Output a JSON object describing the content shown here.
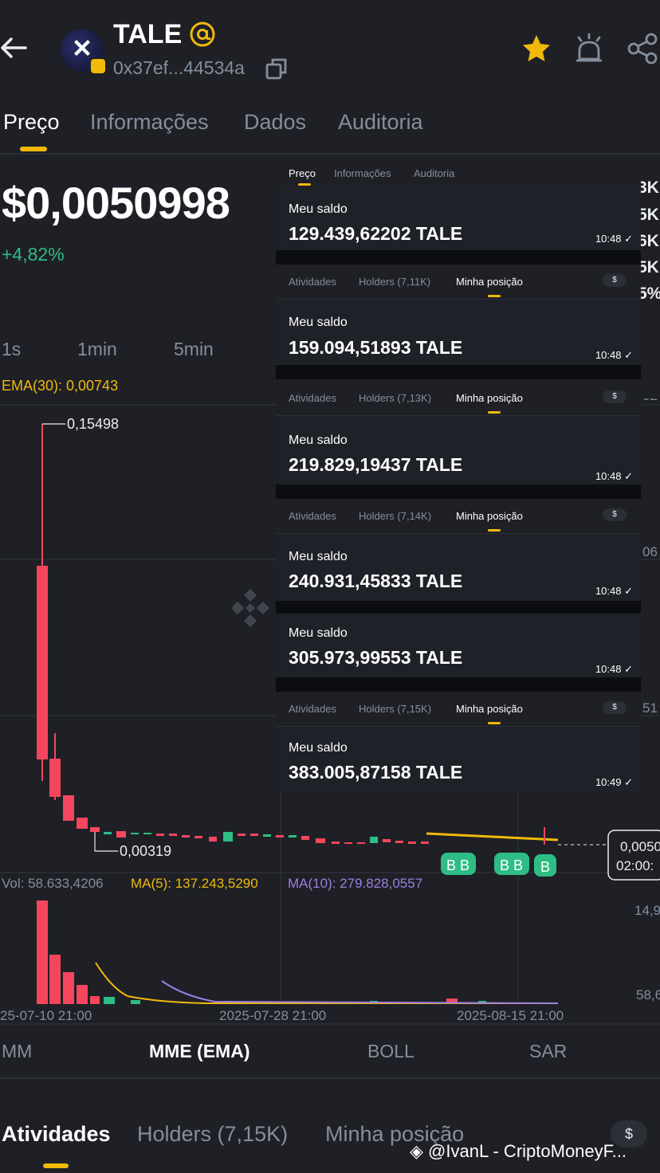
{
  "header": {
    "token_name": "TALE",
    "address": "0x37ef...44534a",
    "icons": [
      "back-arrow-icon",
      "token-logo",
      "at-icon",
      "copy-icon",
      "star-icon",
      "alert-icon",
      "share-icon"
    ]
  },
  "main_tabs": [
    "Preço",
    "Informações",
    "Dados",
    "Auditoria"
  ],
  "price": {
    "value": "$0,0050998",
    "change": "+4,82%"
  },
  "right_stats": [
    "3K",
    "5K",
    "6K",
    "5K",
    "5%"
  ],
  "timeframes": [
    "1s",
    "1min",
    "5min"
  ],
  "ema_label": "EMA(30): 0,00743",
  "chart": {
    "high_label": "0,15498",
    "low_label": "0,00319",
    "current_price_label": "0,0050",
    "current_time_label": "02:00:",
    "right_axis": [
      "62",
      "06",
      "51"
    ],
    "vol_label": "Vol: 58.633,4206",
    "ma5_label": "MA(5): 137.243,5290",
    "ma10_label": "MA(10): 279.828,0557",
    "vol_axis": [
      "14,9",
      "58,6"
    ],
    "dates": [
      "25-07-10 21:00",
      "2025-07-28 21:00",
      "2025-08-15 21:00"
    ],
    "buy_markers": [
      "B",
      "B",
      "B",
      "B",
      "B"
    ]
  },
  "chart_data": {
    "type": "candlestick",
    "title": "",
    "x_labels": [
      "25-07-10 21:00",
      "2025-07-28 21:00",
      "2025-08-15 21:00"
    ],
    "high": 0.15498,
    "low": 0.00319,
    "last": 0.0050998,
    "ema30": 0.00743,
    "volume": 58633.4206,
    "ma5_volume": 137243.529,
    "ma10_volume": 279828.0557
  },
  "indicator_tabs": [
    "MM",
    "MME (EMA)",
    "BOLL",
    "SAR"
  ],
  "bottom_tabs": {
    "atividades": "Atividades",
    "holders": "Holders (7,15K)",
    "minha_posicao": "Minha posição",
    "dollar": "$"
  },
  "watermark": "@IvanL - CriptoMoneyF...",
  "overlay": {
    "first_tabs": [
      "Preço",
      "Informações",
      "Auditoria"
    ],
    "saldo_label": "Meu saldo",
    "entries": [
      {
        "holders": "",
        "value": "129.439,62202 TALE",
        "time": "10:48 ✓"
      },
      {
        "holders": "Holders (7,11K)",
        "value": "159.094,51893 TALE",
        "time": "10:48 ✓"
      },
      {
        "holders": "Holders (7,13K)",
        "value": "219.829,19437 TALE",
        "time": "10:48 ✓"
      },
      {
        "holders": "Holders (7,14K)",
        "value": "240.931,45833 TALE",
        "time": "10:48 ✓"
      },
      {
        "holders": "",
        "value": "305.973,99553 TALE",
        "time": "10:48 ✓"
      },
      {
        "holders": "Holders (7,15K)",
        "value": "383.005,87158 TALE",
        "time": "10:49 ✓"
      }
    ],
    "tab_atividades": "Atividades",
    "tab_minha": "Minha posição",
    "dollar": "$"
  }
}
